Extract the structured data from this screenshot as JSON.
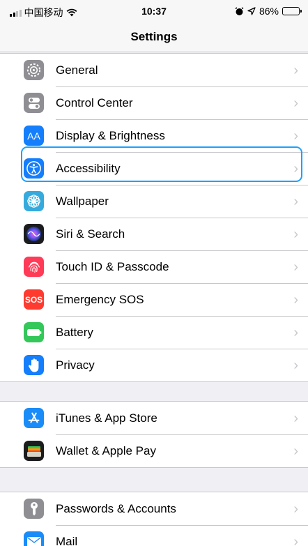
{
  "status_bar": {
    "carrier": "中国移动",
    "time": "10:37",
    "battery": "86%",
    "battery_level": 0.86
  },
  "nav": {
    "title": "Settings"
  },
  "sections": [
    {
      "items": [
        {
          "label": "General",
          "icon": "gear-icon",
          "color": "#8e8e93"
        },
        {
          "label": "Control Center",
          "icon": "toggles-icon",
          "color": "#8e8e93"
        },
        {
          "label": "Display & Brightness",
          "icon": "text-size-icon",
          "color": "#147efb",
          "glyph": "AA"
        },
        {
          "label": "Accessibility",
          "icon": "accessibility-icon",
          "color": "#147efb"
        },
        {
          "label": "Wallpaper",
          "icon": "flower-icon",
          "color": "#36aadc"
        },
        {
          "label": "Siri & Search",
          "icon": "siri-icon",
          "color": "#1c1c1e"
        },
        {
          "label": "Touch ID & Passcode",
          "icon": "fingerprint-icon",
          "color": "#ff3b57"
        },
        {
          "label": "Emergency SOS",
          "icon": "sos-icon",
          "color": "#ff3b30",
          "glyph": "SOS"
        },
        {
          "label": "Battery",
          "icon": "battery-icon",
          "color": "#34c759"
        },
        {
          "label": "Privacy",
          "icon": "hand-icon",
          "color": "#147efb"
        }
      ]
    },
    {
      "items": [
        {
          "label": "iTunes & App Store",
          "icon": "app-store-icon",
          "color": "#1a8cf8"
        },
        {
          "label": "Wallet & Apple Pay",
          "icon": "wallet-icon",
          "color": "#1c1c1e"
        }
      ]
    },
    {
      "items": [
        {
          "label": "Passwords & Accounts",
          "icon": "key-icon",
          "color": "#8e8e93"
        },
        {
          "label": "Mail",
          "icon": "mail-icon",
          "color": "#1a8cf8"
        }
      ]
    }
  ],
  "focused_item": "Accessibility",
  "accent_color": "#1ea0ff"
}
